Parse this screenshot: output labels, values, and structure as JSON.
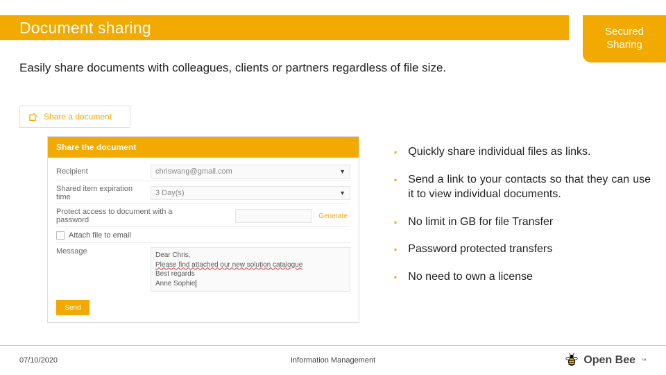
{
  "colors": {
    "accent": "#f2a900"
  },
  "title": "Document sharing",
  "badge": {
    "line1": "Secured",
    "line2": "Sharing"
  },
  "subtitle": "Easily share documents with colleagues, clients or partners regardless of file size.",
  "share_button": {
    "label": "Share a document"
  },
  "form": {
    "header": "Share the document",
    "labels": {
      "recipient": "Recipient",
      "expiration": "Shared item expiration time",
      "protect": "Protect access to document with a",
      "password": "password",
      "generate": "Generate",
      "attach": "Attach file to email",
      "message": "Message"
    },
    "values": {
      "recipient": "chriswang@gmail.com",
      "expiration": "3 Day(s)"
    },
    "message_lines": [
      "Dear Chris,",
      "Please find attached our new solution catalogue",
      "Best regards",
      "Anne Sophie"
    ],
    "send": "Send"
  },
  "bullets": [
    "Quickly share individual files as links.",
    "Send a link to your contacts so that they can use it to view individual documents.",
    "No limit in GB for file Transfer",
    "Password protected transfers",
    "No need to own a license"
  ],
  "footer": {
    "date": "07/10/2020",
    "center": "Information Management",
    "brand": "Open Bee"
  }
}
